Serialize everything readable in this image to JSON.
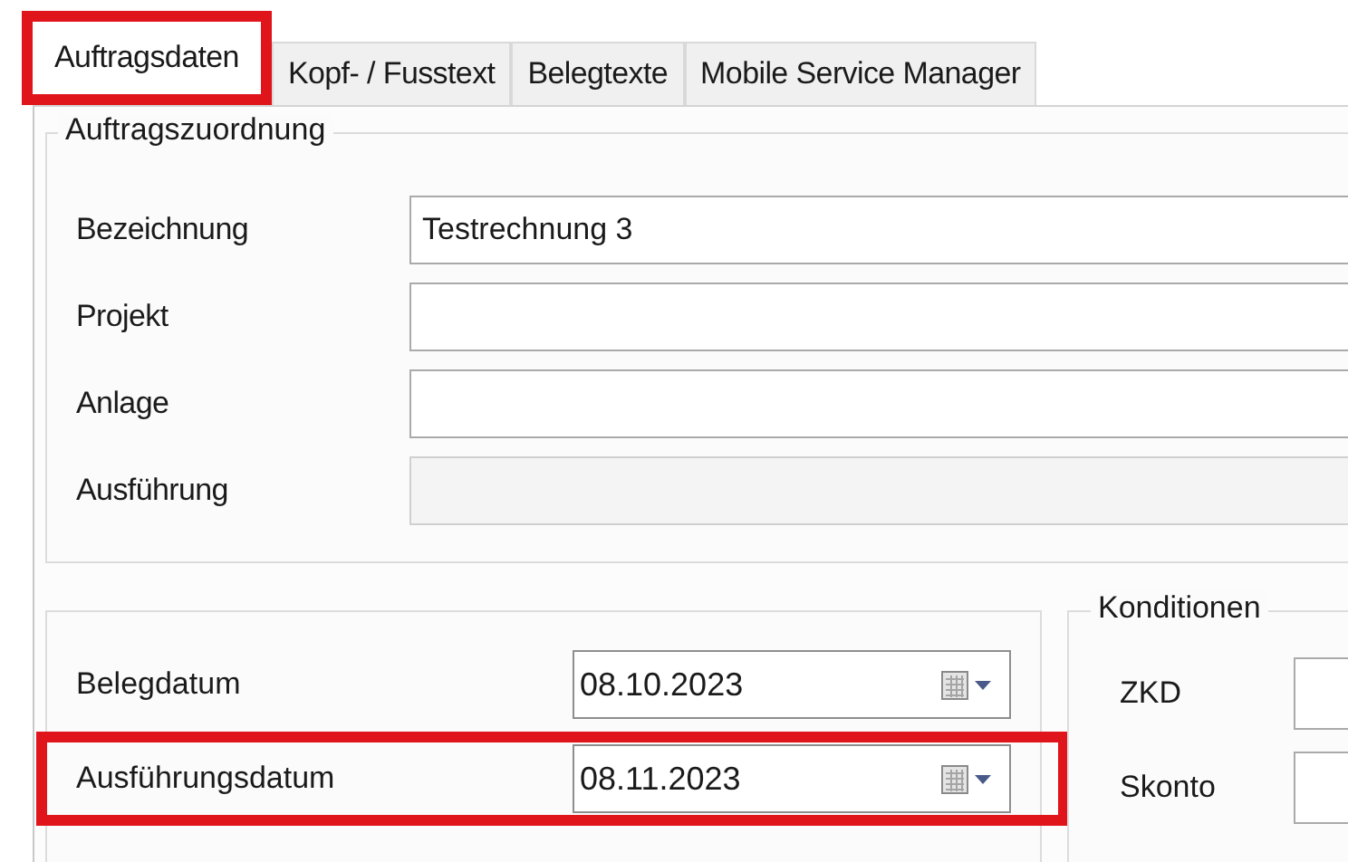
{
  "tabs": [
    {
      "label": "Auftragsdaten",
      "selected": true,
      "highlighted": true
    },
    {
      "label": "Kopf- / Fusstext",
      "selected": false,
      "highlighted": false
    },
    {
      "label": "Belegtexte",
      "selected": false,
      "highlighted": false
    },
    {
      "label": "Mobile Service Manager",
      "selected": false,
      "highlighted": false
    }
  ],
  "assignment_group": {
    "title": "Auftragszuordnung",
    "fields": [
      {
        "label": "Bezeichnung",
        "value": "Testrechnung 3",
        "disabled": false
      },
      {
        "label": "Projekt",
        "disabled": false
      },
      {
        "label": "Anlage",
        "disabled": false
      },
      {
        "label": "Ausführung",
        "disabled": true
      }
    ]
  },
  "dates": [
    {
      "label": "Belegdatum",
      "value": "08.10.2023",
      "highlighted": false
    },
    {
      "label": "Ausführungsdatum",
      "value": "08.11.2023",
      "highlighted": true
    }
  ],
  "conditions_group": {
    "title": "Konditionen",
    "fields": [
      {
        "label": "ZKD"
      },
      {
        "label": "Skonto"
      }
    ]
  }
}
